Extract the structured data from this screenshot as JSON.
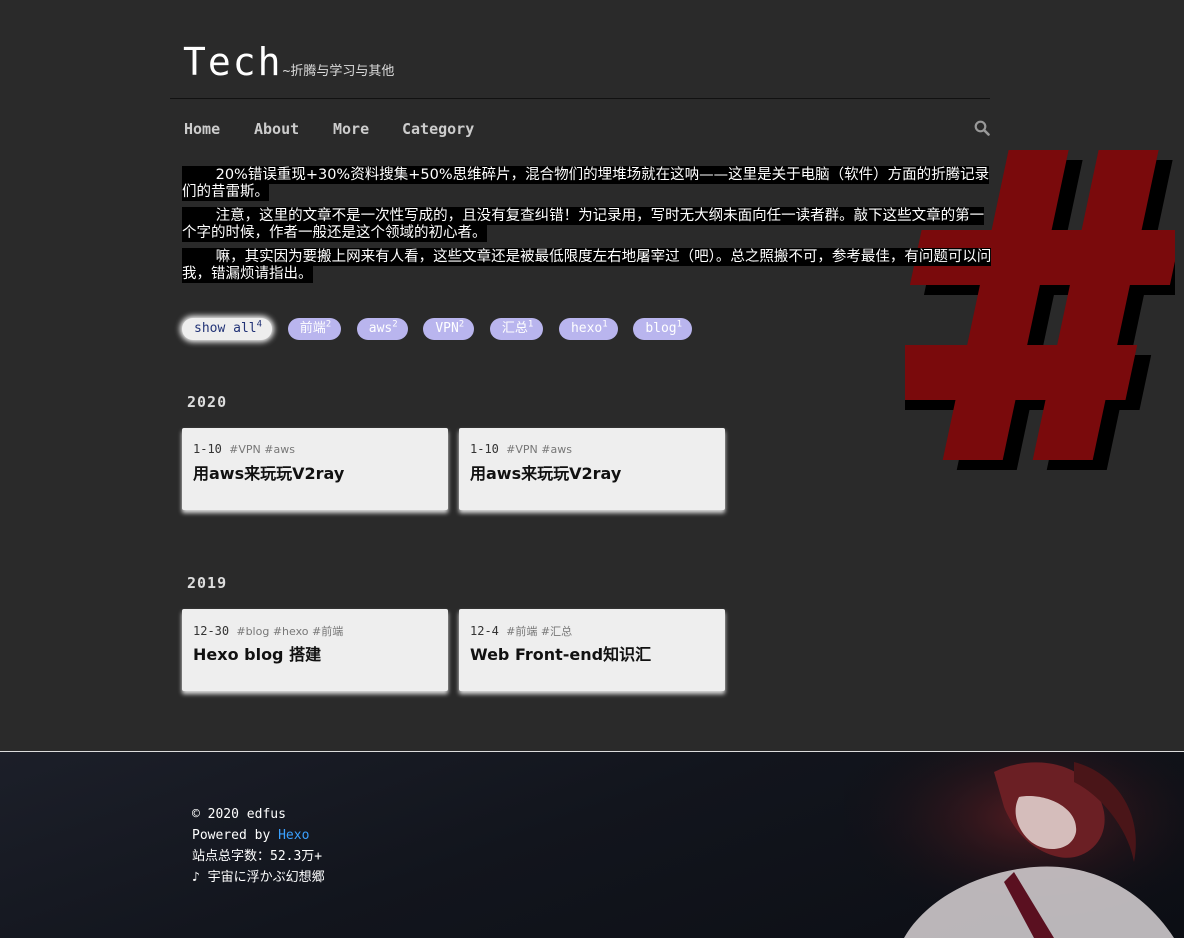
{
  "site": {
    "title": "Tech",
    "subtitle": "~折腾与学习与其他"
  },
  "nav": {
    "items": [
      "Home",
      "About",
      "More",
      "Category"
    ],
    "search_icon": "search-icon"
  },
  "intro": {
    "paragraphs": [
      "　　 20%错误重现+30%资料搜集+50%思维碎片，混合物们的埋堆场就在这呐——这里是关于电脑（软件）方面的折腾记录们的昔雷斯。",
      "　　 注意，这里的文章不是一次性写成的，且没有复查纠错！为记录用，写时无大纲未面向任一读者群。敲下这些文章的第一个字的时候，作者一般还是这个领域的初心者。",
      "　　 嘛，其实因为要搬上网来有人看，这些文章还是被最低限度左右地屠宰过（吧）。总之照搬不可，参考最佳，有问题可以问我，错漏烦请指出。"
    ]
  },
  "tags": [
    {
      "label": "show all",
      "count": "4",
      "active": true
    },
    {
      "label": "前端",
      "count": "2"
    },
    {
      "label": "aws",
      "count": "2"
    },
    {
      "label": "VPN",
      "count": "2"
    },
    {
      "label": "汇总",
      "count": "1"
    },
    {
      "label": "hexo",
      "count": "1"
    },
    {
      "label": "blog",
      "count": "1"
    }
  ],
  "years": [
    {
      "year": "2020",
      "posts": [
        {
          "date": "1-10",
          "tags": "#VPN #aws",
          "title": "用aws来玩玩V2ray"
        },
        {
          "date": "1-10",
          "tags": "#VPN #aws",
          "title": "用aws来玩玩V2ray"
        }
      ]
    },
    {
      "year": "2019",
      "posts": [
        {
          "date": "12-30",
          "tags": "#blog #hexo #前端",
          "title": "Hexo blog 搭建"
        },
        {
          "date": "12-4",
          "tags": "#前端 #汇总",
          "title": "Web Front-end知识汇"
        }
      ]
    }
  ],
  "footer": {
    "copyright": "© 2020 edfus",
    "powered_prefix": "Powered by ",
    "powered_link": "Hexo",
    "wordcount": "站点总字数：52.3万+",
    "music": "♪ 宇宙に浮かぶ幻想郷"
  },
  "colors": {
    "background": "#2a2a2a",
    "tag_bg": "#b9b5ee",
    "hash_red": "#7a0a0c",
    "link_blue": "#3aa0ff"
  }
}
